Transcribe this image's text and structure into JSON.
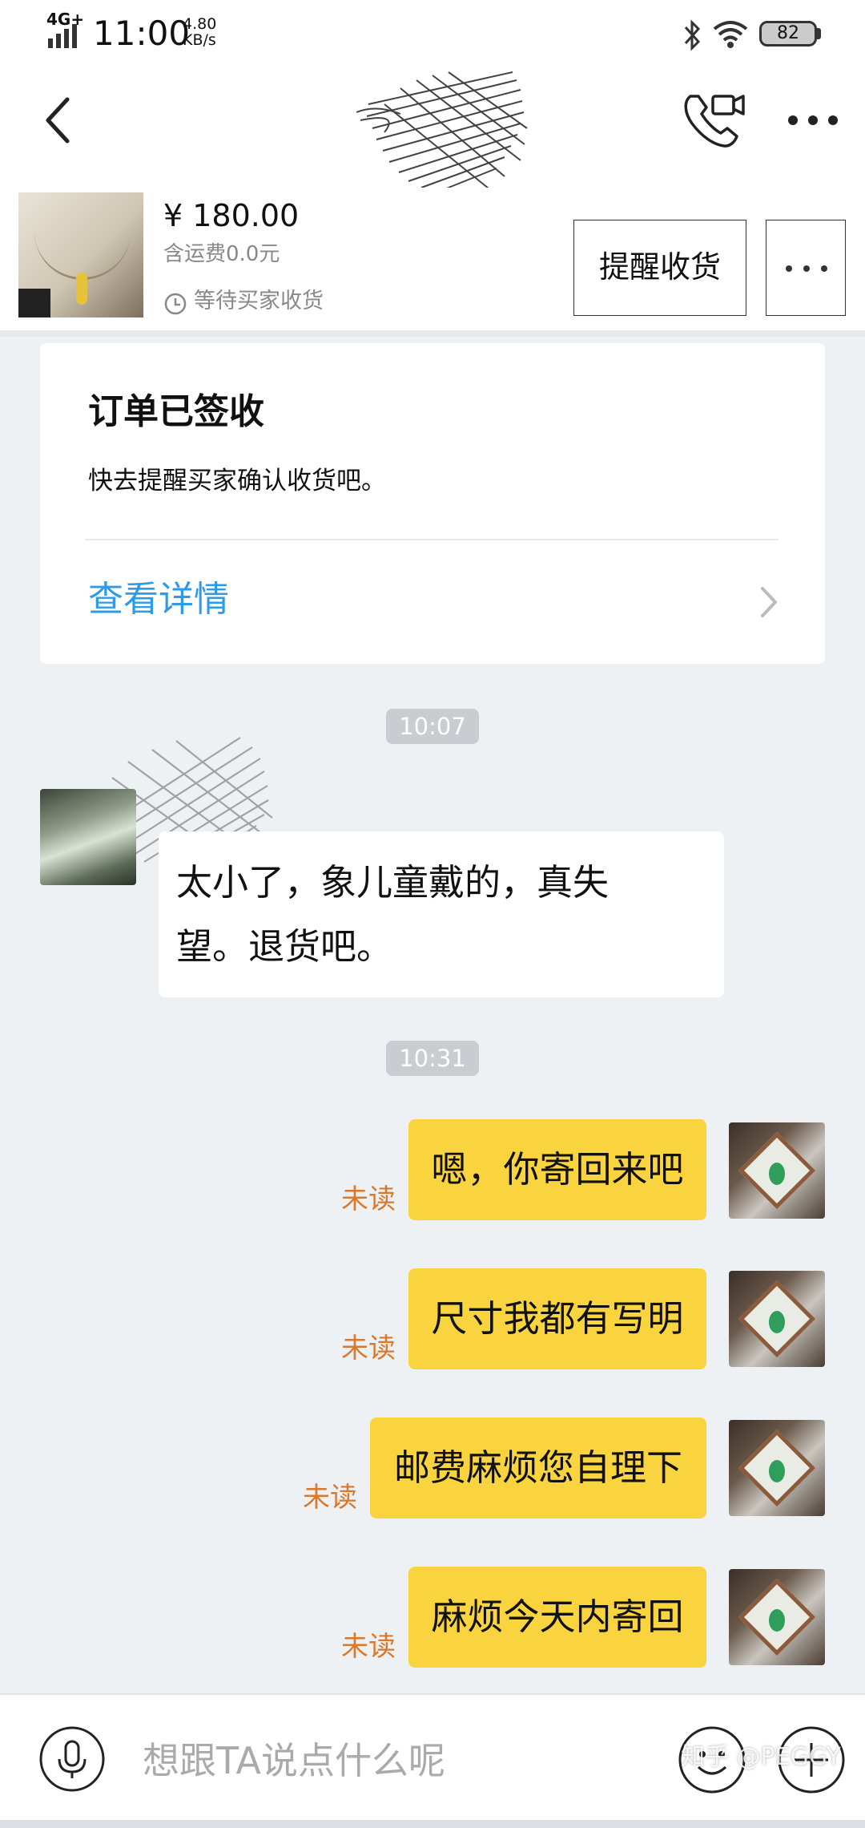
{
  "status_bar": {
    "network": "4G+",
    "time": "11:00",
    "speed_value": "4.80",
    "speed_unit": "KB/s",
    "battery": "82",
    "icons": [
      "signal-icon",
      "bluetooth-icon",
      "wifi-icon",
      "battery-icon"
    ]
  },
  "header": {
    "icons": [
      "back-icon",
      "video-call-icon",
      "more-icon"
    ]
  },
  "product": {
    "price": "¥ 180.00",
    "shipping": "含运费0.0元",
    "status": "等待买家收货",
    "remind_button": "提醒收货"
  },
  "order_card": {
    "title": "订单已签收",
    "description": "快去提醒买家确认收货吧。",
    "link": "查看详情"
  },
  "messages": [
    {
      "type": "time",
      "text": "10:07"
    },
    {
      "type": "incoming",
      "text_line1": "太小了，象儿童戴的，真失",
      "text_line2": "望。退货吧。"
    },
    {
      "type": "time",
      "text": "10:31"
    },
    {
      "type": "outgoing",
      "text": "嗯，你寄回来吧",
      "status": "未读"
    },
    {
      "type": "outgoing",
      "text": "尺寸我都有写明",
      "status": "未读"
    },
    {
      "type": "outgoing",
      "text": "邮费麻烦您自理下",
      "status": "未读"
    },
    {
      "type": "outgoing",
      "text": "麻烦今天内寄回",
      "status": "未读"
    }
  ],
  "input": {
    "placeholder": "想跟TA说点什么呢",
    "icons": [
      "microphone-icon",
      "emoji-icon",
      "plus-icon"
    ]
  },
  "watermark": "知乎 @PEGGY",
  "colors": {
    "accent_link": "#2e9be8",
    "outgoing_bubble": "#f9d43f",
    "unread_text": "#d8792e",
    "chat_background": "#eef1f4"
  }
}
